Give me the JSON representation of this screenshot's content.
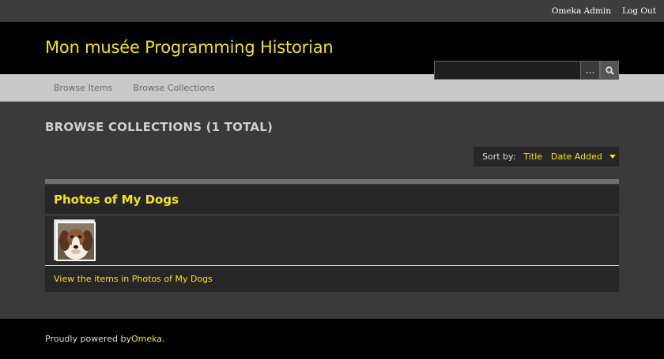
{
  "topbar": {
    "admin_label": "Omeka Admin",
    "logout_label": "Log Out"
  },
  "header": {
    "site_title": "Mon musée Programming Historian",
    "search": {
      "value": "",
      "advanced_label": "…",
      "submit_icon": "search-icon"
    }
  },
  "nav": {
    "items": [
      {
        "label": "Browse Items"
      },
      {
        "label": "Browse Collections"
      }
    ]
  },
  "main": {
    "heading": "BROWSE COLLECTIONS (1 TOTAL)",
    "sort": {
      "label": "Sort by:",
      "options": [
        {
          "label": "Title"
        },
        {
          "label": "Date Added"
        }
      ]
    },
    "collections": [
      {
        "title": "Photos of My Dogs",
        "view_link": "View the items in Photos of My Dogs",
        "thumbnail": "dog-photo"
      }
    ]
  },
  "footer": {
    "prefix": "Proudly powered by ",
    "link": "Omeka",
    "suffix": "."
  },
  "colors": {
    "accent": "#f5e21a",
    "header_bg": "#000000",
    "body_bg": "#3a3a3a",
    "nav_bg": "#c9c9c9"
  }
}
